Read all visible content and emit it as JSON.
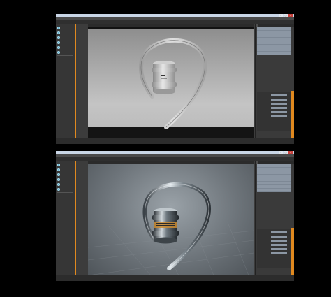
{
  "windows": [
    {
      "title": "",
      "menu": [
        "",
        "",
        "",
        "",
        "",
        ""
      ],
      "toolbar": [
        "",
        "",
        "",
        ""
      ],
      "tools": [
        "",
        "",
        "",
        "",
        "",
        "",
        "",
        "",
        "",
        ""
      ],
      "viewport_tabs": [
        "",
        "",
        "",
        ""
      ],
      "panel_tabs": [
        "",
        "",
        ""
      ],
      "items": [
        "",
        "",
        "",
        "",
        "",
        "",
        "",
        ""
      ],
      "properties": [
        {
          "label": "",
          "value": ""
        },
        {
          "label": "",
          "value": ""
        },
        {
          "label": "",
          "value": ""
        },
        {
          "label": "",
          "value": ""
        },
        {
          "label": "",
          "value": ""
        },
        {
          "label": "",
          "value": ""
        }
      ],
      "status": "",
      "viewport_style": "flat-gray"
    },
    {
      "title": "",
      "menu": [
        "",
        "",
        "",
        "",
        "",
        ""
      ],
      "toolbar": [
        "",
        "",
        "",
        "",
        "",
        "",
        "",
        "",
        "",
        ""
      ],
      "tools": [
        "",
        "",
        "",
        "",
        "",
        "",
        "",
        "",
        "",
        ""
      ],
      "viewport_tabs": [
        "",
        "",
        "",
        ""
      ],
      "panel_tabs": [
        "",
        "",
        ""
      ],
      "items": [
        "",
        "",
        "",
        "",
        "",
        "",
        "",
        ""
      ],
      "properties": [
        {
          "label": "",
          "value": ""
        },
        {
          "label": "",
          "value": ""
        },
        {
          "label": "",
          "value": ""
        },
        {
          "label": "",
          "value": ""
        },
        {
          "label": "",
          "value": ""
        },
        {
          "label": "",
          "value": ""
        }
      ],
      "viewport_readout": [
        "",
        "",
        "",
        ""
      ],
      "status": "",
      "viewport_style": "advanced-render"
    }
  ],
  "colors": {
    "accent": "#e0891f",
    "panel": "#3a3a3a",
    "list_row": "#8c97a4",
    "titlebar": "#c9d6e6",
    "tool_icon": "#5aa9c9"
  }
}
